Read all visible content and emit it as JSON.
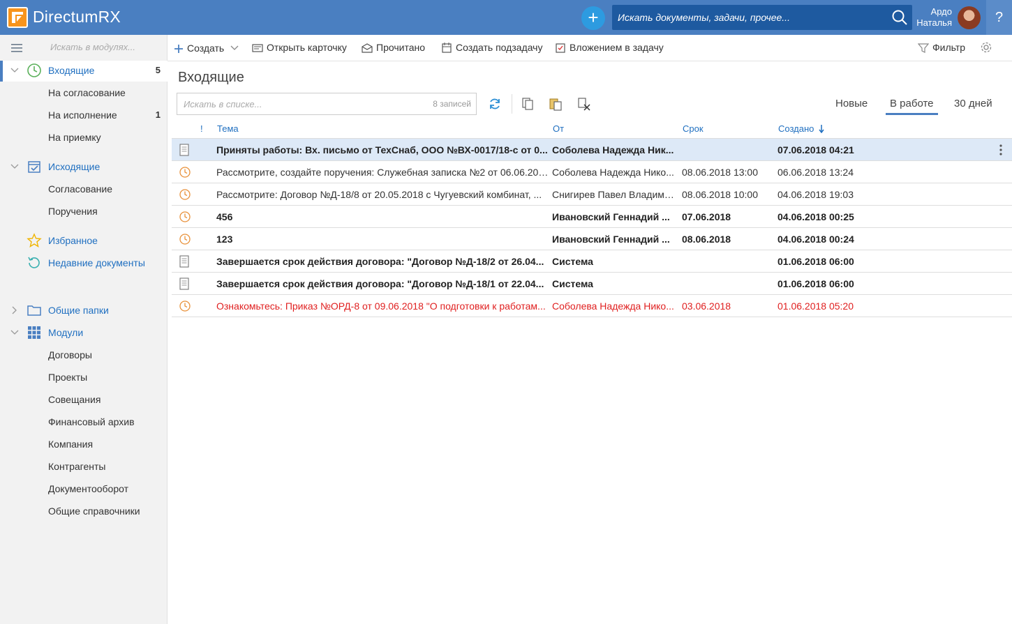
{
  "header": {
    "app_title": "DirectumRX",
    "search_placeholder": "Искать документы, задачи, прочее...",
    "user_line1": "Ардо",
    "user_line2": "Наталья",
    "help": "?"
  },
  "sidebar": {
    "module_search_placeholder": "Искать в модулях...",
    "inbox": {
      "label": "Входящие",
      "count": "5"
    },
    "inbox_sub": [
      {
        "label": "На согласование",
        "count": ""
      },
      {
        "label": "На исполнение",
        "count": "1"
      },
      {
        "label": "На приемку",
        "count": ""
      }
    ],
    "outbox": {
      "label": "Исходящие"
    },
    "outbox_sub": [
      {
        "label": "Согласование"
      },
      {
        "label": "Поручения"
      }
    ],
    "favorites": "Избранное",
    "recent": "Недавние документы",
    "shared_folders": "Общие папки",
    "modules": "Модули",
    "modules_sub": [
      "Договоры",
      "Проекты",
      "Совещания",
      "Финансовый архив",
      "Компания",
      "Контрагенты",
      "Документооборот",
      "Общие справочники"
    ]
  },
  "toolbar": {
    "create": "Создать",
    "open_card": "Открыть карточку",
    "read": "Прочитано",
    "create_subtask": "Создать подзадачу",
    "attach_to_task": "Вложением в задачу",
    "filter": "Фильтр"
  },
  "main": {
    "title": "Входящие",
    "list_search_placeholder": "Искать в списке...",
    "record_count": "8 записей",
    "view_tabs": [
      "Новые",
      "В работе",
      "30 дней"
    ],
    "active_tab": "В работе"
  },
  "grid": {
    "columns": {
      "importance": "!",
      "subject": "Тема",
      "from": "От",
      "deadline": "Срок",
      "created": "Создано"
    },
    "rows": [
      {
        "icon": "document-icon",
        "subject": "Приняты работы: Вх. письмо от ТехСнаб, ООО №ВХ-0017/18-с от 0...",
        "from": "Соболева Надежда Ник...",
        "deadline": "",
        "created": "07.06.2018 04:21",
        "style": "bold selected"
      },
      {
        "icon": "clock-icon",
        "subject": "Рассмотрите, создайте поручения: Служебная записка №2 от 06.06.201...",
        "from": "Соболева Надежда Нико...",
        "deadline": "08.06.2018 13:00",
        "created": "06.06.2018 13:24",
        "style": ""
      },
      {
        "icon": "clock-icon",
        "subject": "Рассмотрите: Договор №Д-18/8 от 20.05.2018 с Чугуевский комбинат, ...",
        "from": "Снигирев Павел Владими...",
        "deadline": "08.06.2018 10:00",
        "created": "04.06.2018 19:03",
        "style": ""
      },
      {
        "icon": "clock-icon",
        "subject": "456",
        "from": "Ивановский Геннадий ...",
        "deadline": "07.06.2018",
        "created": "04.06.2018 00:25",
        "style": "bold"
      },
      {
        "icon": "clock-icon",
        "subject": "123",
        "from": "Ивановский Геннадий ...",
        "deadline": "08.06.2018",
        "created": "04.06.2018 00:24",
        "style": "bold"
      },
      {
        "icon": "document-icon",
        "subject": "Завершается срок действия договора: \"Договор №Д-18/2 от 26.04...",
        "from": "Система",
        "deadline": "",
        "created": "01.06.2018 06:00",
        "style": "bold"
      },
      {
        "icon": "document-icon",
        "subject": "Завершается срок действия договора: \"Договор №Д-18/1 от 22.04...",
        "from": "Система",
        "deadline": "",
        "created": "01.06.2018 06:00",
        "style": "bold"
      },
      {
        "icon": "clock-icon",
        "subject": "Ознакомьтесь: Приказ №ОРД-8 от 09.06.2018 \"О подготовки к работам...",
        "from": "Соболева Надежда Нико...",
        "deadline": "03.06.2018",
        "created": "01.06.2018 05:20",
        "style": "overdue"
      }
    ]
  },
  "colors": {
    "header": "#4a7fc1",
    "link": "#1f6fc0",
    "accent_orange": "#f7941d",
    "overdue": "#e02020",
    "selected_row": "#dde9f7"
  }
}
